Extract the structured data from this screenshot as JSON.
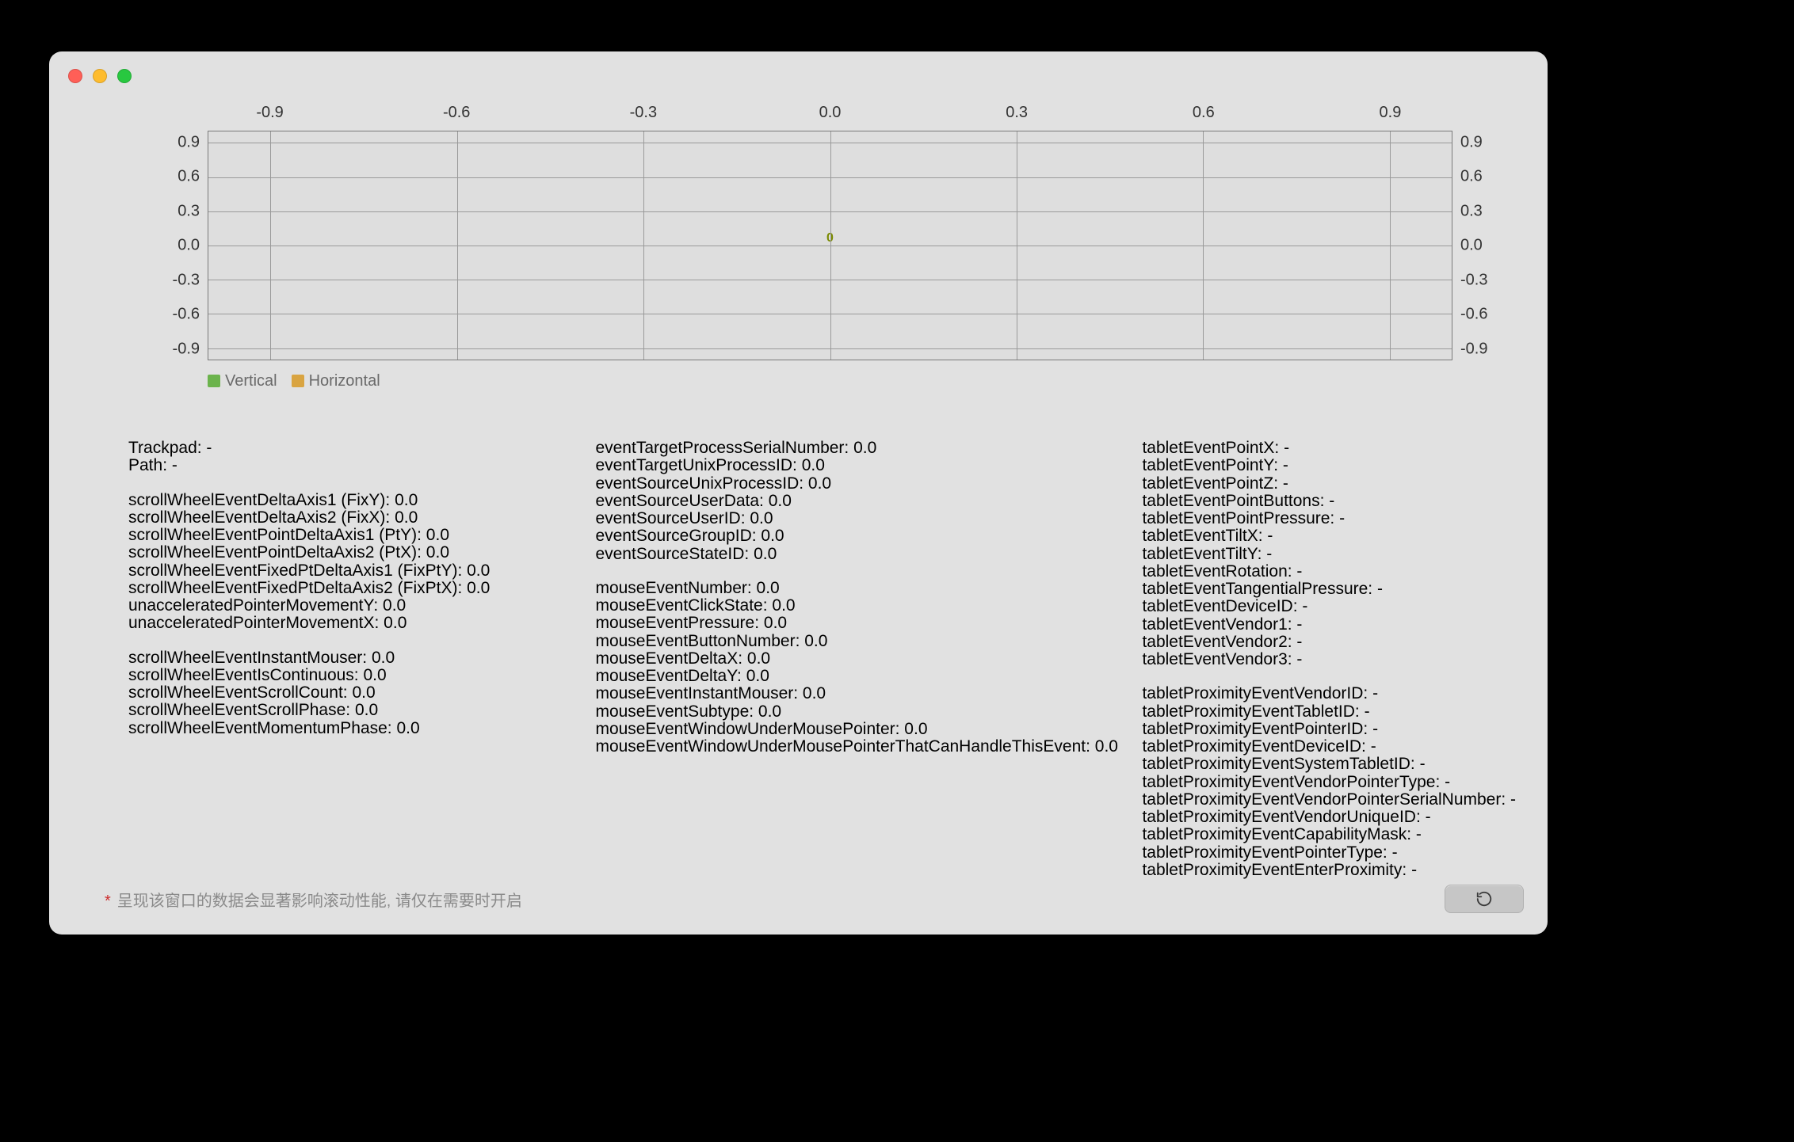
{
  "chart_data": {
    "type": "line",
    "x": [],
    "series": [
      {
        "name": "Vertical",
        "values": [],
        "color": "#6bb34c"
      },
      {
        "name": "Horizontal",
        "values": [],
        "color": "#d9a441"
      }
    ],
    "xticks": [
      -0.9,
      -0.6,
      -0.3,
      0.0,
      0.3,
      0.6,
      0.9
    ],
    "yticks": [
      0.9,
      0.6,
      0.3,
      0.0,
      -0.3,
      -0.6,
      -0.9
    ],
    "xlim": [
      -1,
      1
    ],
    "ylim": [
      -1,
      1
    ],
    "center_label": "0",
    "legend_position": "bottom-left"
  },
  "header": {
    "trackpad_label": "Trackpad:",
    "trackpad_value": "-",
    "path_label": "Path:",
    "path_value": "-"
  },
  "col1_a": [
    {
      "k": "scrollWheelEventDeltaAxis1 (FixY)",
      "v": "0.0"
    },
    {
      "k": "scrollWheelEventDeltaAxis2 (FixX)",
      "v": "0.0"
    },
    {
      "k": "scrollWheelEventPointDeltaAxis1 (PtY)",
      "v": "0.0"
    },
    {
      "k": "scrollWheelEventPointDeltaAxis2 (PtX)",
      "v": "0.0"
    },
    {
      "k": "scrollWheelEventFixedPtDeltaAxis1 (FixPtY)",
      "v": "0.0"
    },
    {
      "k": "scrollWheelEventFixedPtDeltaAxis2 (FixPtX)",
      "v": "0.0"
    },
    {
      "k": "unacceleratedPointerMovementY",
      "v": "0.0"
    },
    {
      "k": "unacceleratedPointerMovementX",
      "v": "0.0"
    }
  ],
  "col1_b": [
    {
      "k": "scrollWheelEventInstantMouser",
      "v": "0.0"
    },
    {
      "k": "scrollWheelEventIsContinuous",
      "v": "0.0"
    },
    {
      "k": "scrollWheelEventScrollCount",
      "v": "0.0"
    },
    {
      "k": "scrollWheelEventScrollPhase",
      "v": "0.0"
    },
    {
      "k": "scrollWheelEventMomentumPhase",
      "v": "0.0"
    }
  ],
  "col2_a": [
    {
      "k": "eventTargetProcessSerialNumber",
      "v": "0.0"
    },
    {
      "k": "eventTargetUnixProcessID",
      "v": "0.0"
    },
    {
      "k": "eventSourceUnixProcessID",
      "v": "0.0"
    },
    {
      "k": "eventSourceUserData",
      "v": "0.0"
    },
    {
      "k": "eventSourceUserID",
      "v": "0.0"
    },
    {
      "k": "eventSourceGroupID",
      "v": "0.0"
    },
    {
      "k": "eventSourceStateID",
      "v": "0.0"
    }
  ],
  "col2_b": [
    {
      "k": "mouseEventNumber",
      "v": "0.0"
    },
    {
      "k": "mouseEventClickState",
      "v": "0.0"
    },
    {
      "k": "mouseEventPressure",
      "v": "0.0"
    },
    {
      "k": "mouseEventButtonNumber",
      "v": "0.0"
    },
    {
      "k": "mouseEventDeltaX",
      "v": "0.0"
    },
    {
      "k": "mouseEventDeltaY",
      "v": "0.0"
    },
    {
      "k": "mouseEventInstantMouser",
      "v": "0.0"
    },
    {
      "k": "mouseEventSubtype",
      "v": "0.0"
    },
    {
      "k": "mouseEventWindowUnderMousePointer",
      "v": "0.0"
    },
    {
      "k": "mouseEventWindowUnderMousePointerThatCanHandleThisEvent",
      "v": "0.0"
    }
  ],
  "col3_a": [
    {
      "k": "tabletEventPointX",
      "v": "-"
    },
    {
      "k": "tabletEventPointY",
      "v": "-"
    },
    {
      "k": "tabletEventPointZ",
      "v": "-"
    },
    {
      "k": "tabletEventPointButtons",
      "v": "-"
    },
    {
      "k": "tabletEventPointPressure",
      "v": "-"
    },
    {
      "k": "tabletEventTiltX",
      "v": "-"
    },
    {
      "k": "tabletEventTiltY",
      "v": "-"
    },
    {
      "k": "tabletEventRotation",
      "v": "-"
    },
    {
      "k": "tabletEventTangentialPressure",
      "v": "-"
    },
    {
      "k": "tabletEventDeviceID",
      "v": "-"
    },
    {
      "k": "tabletEventVendor1",
      "v": "-"
    },
    {
      "k": "tabletEventVendor2",
      "v": "-"
    },
    {
      "k": "tabletEventVendor3",
      "v": "-"
    }
  ],
  "col3_b": [
    {
      "k": "tabletProximityEventVendorID",
      "v": "-"
    },
    {
      "k": "tabletProximityEventTabletID",
      "v": "-"
    },
    {
      "k": "tabletProximityEventPointerID",
      "v": "-"
    },
    {
      "k": "tabletProximityEventDeviceID",
      "v": "-"
    },
    {
      "k": "tabletProximityEventSystemTabletID",
      "v": "-"
    },
    {
      "k": "tabletProximityEventVendorPointerType",
      "v": "-"
    },
    {
      "k": "tabletProximityEventVendorPointerSerialNumber",
      "v": "-"
    },
    {
      "k": "tabletProximityEventVendorUniqueID",
      "v": "-"
    },
    {
      "k": "tabletProximityEventCapabilityMask",
      "v": "-"
    },
    {
      "k": "tabletProximityEventPointerType",
      "v": "-"
    },
    {
      "k": "tabletProximityEventEnterProximity",
      "v": "-"
    }
  ],
  "footer": {
    "star": "*",
    "note": "呈现该窗口的数据会显著影响滚动性能, 请仅在需要时开启"
  },
  "legend": {
    "vertical": "Vertical",
    "horizontal": "Horizontal"
  }
}
